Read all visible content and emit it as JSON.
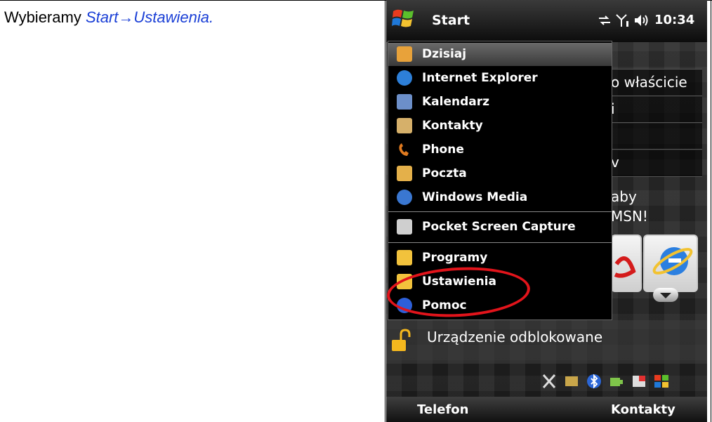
{
  "instruction": {
    "prefix": "Wybieramy ",
    "path": "Start→Ustawienia."
  },
  "phone": {
    "title": "Start",
    "clock": "10:34",
    "today_rows": [
      "o właścicie",
      "i",
      "",
      "v",
      "aby",
      "MSN!"
    ],
    "lock_label": "Urządzenie odblokowane",
    "softkeys": {
      "left": "Telefon",
      "right": "Kontakty"
    },
    "menu": [
      {
        "label": "Dzisiaj",
        "icon": "today-icon",
        "color": "#e8a23a"
      },
      {
        "label": "Internet Explorer",
        "icon": "internet-explorer-icon",
        "color": "#2d7fd8"
      },
      {
        "label": "Kalendarz",
        "icon": "calendar-icon",
        "color": "#6c8fc9"
      },
      {
        "label": "Kontakty",
        "icon": "contacts-icon",
        "color": "#d6b06a"
      },
      {
        "label": "Phone",
        "icon": "phone-icon",
        "color": "#e07a1f"
      },
      {
        "label": "Poczta",
        "icon": "mail-icon",
        "color": "#e4b04a"
      },
      {
        "label": "Windows Media",
        "icon": "windows-media-icon",
        "color": "#3a77d1"
      },
      {
        "label": "Pocket Screen Capture",
        "icon": "camera-icon",
        "color": "#cfcfcf"
      },
      {
        "label": "Programy",
        "icon": "folder-icon",
        "color": "#f2c23c"
      },
      {
        "label": "Ustawienia",
        "icon": "settings-folder-icon",
        "color": "#f2c23c"
      },
      {
        "label": "Pomoc",
        "icon": "help-icon",
        "color": "#2d5fd8"
      }
    ],
    "highlight_color": "#e2141b"
  }
}
